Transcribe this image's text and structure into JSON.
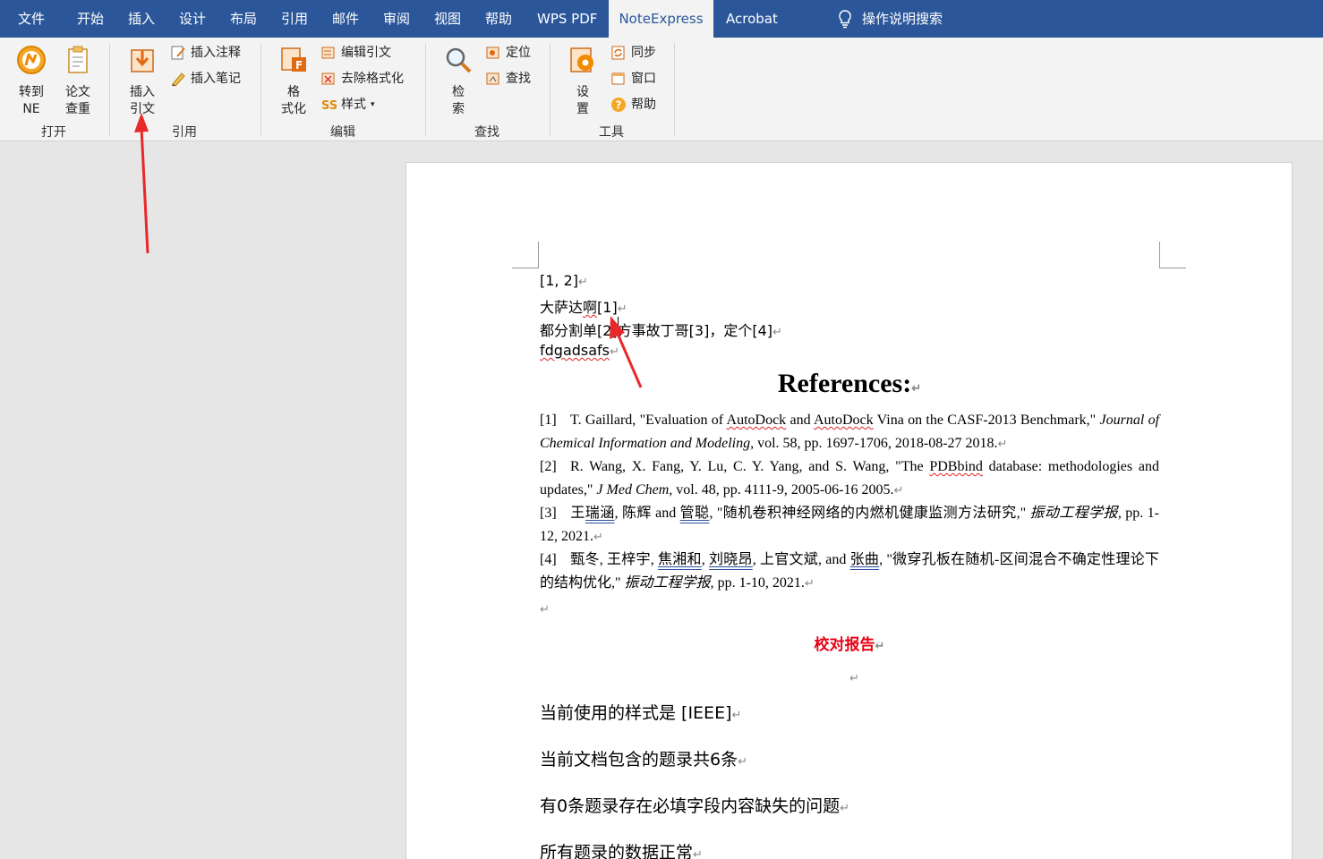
{
  "menu": {
    "tabs": [
      "文件",
      "开始",
      "插入",
      "设计",
      "布局",
      "引用",
      "邮件",
      "审阅",
      "视图",
      "帮助",
      "WPS PDF",
      "NoteExpress",
      "Acrobat"
    ],
    "active_tab": "NoteExpress",
    "search_label": "操作说明搜索"
  },
  "ribbon": {
    "groups": {
      "open": "打开",
      "cite": "引用",
      "edit": "编辑",
      "find": "查找",
      "tools": "工具"
    },
    "buttons": {
      "goto_ne": "转到\nNE",
      "paper_check": "论文\n查重",
      "insert_citation": "插入\n引文",
      "insert_note": "插入注释",
      "insert_memo": "插入笔记",
      "format": "格\n式化",
      "edit_citation": "编辑引文",
      "remove_format": "去除格式化",
      "style": "样式",
      "search": "检\n索",
      "locate": "定位",
      "find": "查找",
      "settings": "设\n置",
      "sync": "同步",
      "window": "窗口",
      "help": "帮助"
    }
  },
  "document": {
    "lines": {
      "l1": "[1, 2]",
      "l2a": "大萨达",
      "l2b": "啊",
      "l2c": "[1]",
      "l3": "都分割单[2]方事故丁哥[3]，定个[4]",
      "l4": "fdgadsafs"
    },
    "references_title": "References:",
    "references": [
      {
        "num": "[1]",
        "a": "T. Gaillard, \"Evaluation of ",
        "b": "AutoDock",
        "c": " and ",
        "d": "AutoDock",
        "e": " Vina on the CASF-2013 Benchmark,\" ",
        "journal": "Journal of Chemical Information and Modeling,",
        "tail": " vol. 58, pp. 1697-1706, 2018-08-27 2018."
      },
      {
        "num": "[2]",
        "a": "R. Wang, X. Fang, Y. Lu, C. Y. Yang, and S. Wang, \"The ",
        "b": "PDBbind",
        "c": " database: methodologies and updates,\" ",
        "journal": "J Med Chem,",
        "tail": " vol. 48, pp. 4111-9, 2005-06-16 2005."
      },
      {
        "num": "[3]",
        "a": "王",
        "b": "瑞涵",
        "c": ", 陈辉 and ",
        "d": "管聪",
        "e": ", \"随机卷积神经网络的内燃机健康监测方法研究,\" ",
        "journal": "振动工程学报,",
        "tail": " pp. 1-12, 2021."
      },
      {
        "num": "[4]",
        "a": "甄冬, 王梓宇, ",
        "b": "焦湘和",
        "c": ", ",
        "d": "刘晓昂",
        "e": ", 上官文斌, and ",
        "f": "张曲",
        "g": ", \"微穿孔板在随机-区间混合不确定性理论下的结构优化,\" ",
        "journal": "振动工程学报,",
        "tail": " pp. 1-10, 2021."
      }
    ],
    "report_title": "校对报告",
    "report_lines": [
      "当前使用的样式是  [IEEE]",
      "当前文档包含的题录共6条",
      "有0条题录存在必填字段内容缺失的问题",
      "所有题录的数据正常"
    ],
    "para_mark": "↵"
  }
}
